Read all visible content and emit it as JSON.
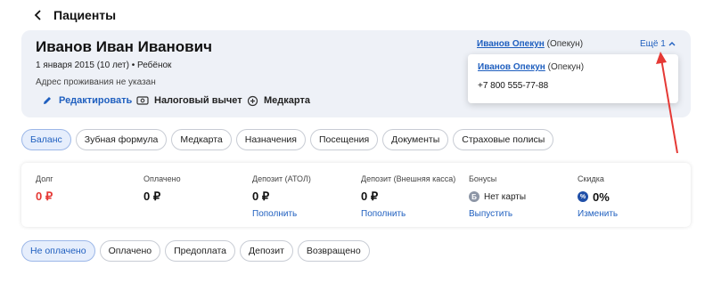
{
  "header": {
    "title": "Пациенты"
  },
  "patient": {
    "name": "Иванов Иван Иванович",
    "dob": "1 января 2015 (10 лет) • Ребёнок",
    "address": "Адрес проживания не указан",
    "actions": {
      "edit": "Редактировать",
      "tax": "Налоговый вычет",
      "medcard": "Медкарта"
    },
    "guardian": {
      "name": "Иванов Опекун",
      "role": "(Опекун)"
    },
    "more_label": "Ещё 1",
    "popover": {
      "name": "Иванов Опекун",
      "role": "(Опекун)",
      "phone": "+7 800 555-77-88"
    }
  },
  "tabs": [
    {
      "label": "Баланс",
      "active": true
    },
    {
      "label": "Зубная формула"
    },
    {
      "label": "Медкарта"
    },
    {
      "label": "Назначения"
    },
    {
      "label": "Посещения"
    },
    {
      "label": "Документы"
    },
    {
      "label": "Страховые полисы"
    }
  ],
  "finance": {
    "debt": {
      "label": "Долг",
      "value": "0 ₽"
    },
    "paid": {
      "label": "Оплачено",
      "value": "0 ₽"
    },
    "deposit_atol": {
      "label": "Депозит (АТОЛ)",
      "value": "0 ₽",
      "link": "Пополнить"
    },
    "deposit_ext": {
      "label": "Депозит (Внешняя касса)",
      "value": "0 ₽",
      "link": "Пополнить"
    },
    "bonus": {
      "label": "Бонусы",
      "value": "Нет карты",
      "link": "Выпустить"
    },
    "discount": {
      "label": "Скидка",
      "value": "0%",
      "link": "Изменить"
    }
  },
  "filters": [
    {
      "label": "Не оплачено",
      "active": true
    },
    {
      "label": "Оплачено"
    },
    {
      "label": "Предоплата"
    },
    {
      "label": "Депозит"
    },
    {
      "label": "Возвращено"
    }
  ],
  "colors": {
    "accent": "#1f5fbf",
    "debt": "#e53935",
    "annotation_arrow": "#e53935"
  }
}
